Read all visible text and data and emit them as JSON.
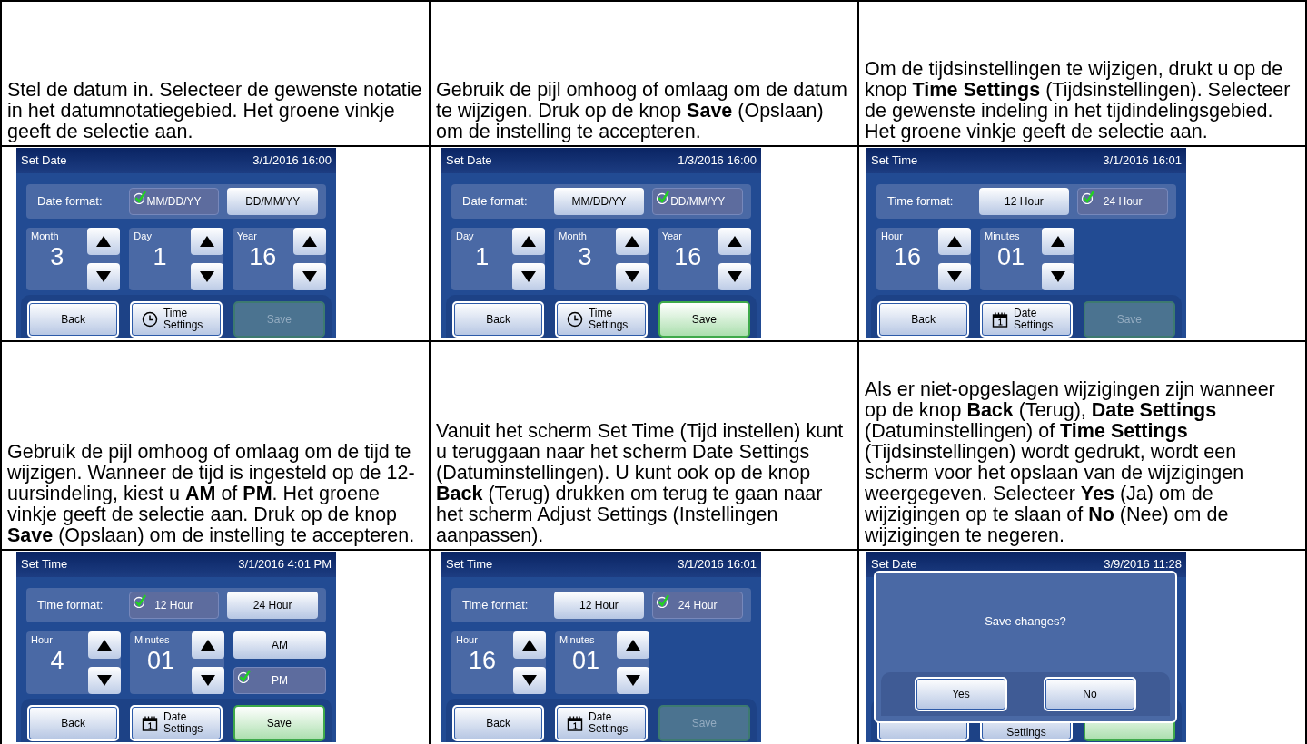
{
  "steps": [
    {
      "instruction": "Stel de datum in. Selecteer de gewenste notatie in het datumnotatiegebied. Het groene vinkje geeft de selectie aan.",
      "screen": {
        "kind": "settings",
        "title": "Set Date",
        "datetime": "3/1/2016 16:00",
        "format": {
          "label": "Date format:",
          "options": [
            {
              "label": "MM/DD/YY",
              "selected": true
            },
            {
              "label": "DD/MM/YY",
              "selected": false
            }
          ]
        },
        "spinners": [
          {
            "label": "Month",
            "value": "3"
          },
          {
            "label": "Day",
            "value": "1"
          },
          {
            "label": "Year",
            "value": "16"
          }
        ],
        "buttons": [
          {
            "kind": "plain",
            "label": "Back"
          },
          {
            "kind": "time",
            "label": "Time Settings"
          },
          {
            "kind": "save",
            "label": "Save",
            "disabled": true
          }
        ]
      }
    },
    {
      "instruction": "Gebruik de pijl omhoog of omlaag om de datum te wijzigen. Druk op de knop **Save** (Opslaan) om de instelling te accepteren.",
      "screen": {
        "kind": "settings",
        "title": "Set Date",
        "datetime": "1/3/2016 16:00",
        "format": {
          "label": "Date format:",
          "options": [
            {
              "label": "MM/DD/YY",
              "selected": false
            },
            {
              "label": "DD/MM/YY",
              "selected": true
            }
          ]
        },
        "spinners": [
          {
            "label": "Day",
            "value": "1"
          },
          {
            "label": "Month",
            "value": "3"
          },
          {
            "label": "Year",
            "value": "16"
          }
        ],
        "buttons": [
          {
            "kind": "plain",
            "label": "Back"
          },
          {
            "kind": "time",
            "label": "Time Settings"
          },
          {
            "kind": "save",
            "label": "Save",
            "disabled": false
          }
        ]
      }
    },
    {
      "instruction": "Om de tijdsinstellingen te wijzigen, drukt u op de knop **Time Settings** (Tijdsinstellingen). Selecteer de gewenste indeling in het tijdindelingsgebied. Het groene vinkje geeft de selectie aan.",
      "screen": {
        "kind": "settings",
        "title": "Set Time",
        "datetime": "3/1/2016 16:01",
        "format": {
          "label": "Time format:",
          "options": [
            {
              "label": "12 Hour",
              "selected": false
            },
            {
              "label": "24 Hour",
              "selected": true
            }
          ]
        },
        "spinners": [
          {
            "label": "Hour",
            "value": "16"
          },
          {
            "label": "Minutes",
            "value": "01"
          }
        ],
        "buttons": [
          {
            "kind": "plain",
            "label": "Back"
          },
          {
            "kind": "date",
            "label": "Date Settings"
          },
          {
            "kind": "save",
            "label": "Save",
            "disabled": true
          }
        ]
      }
    },
    {
      "instruction": "Gebruik de pijl omhoog of omlaag om de tijd te wijzigen. Wanneer de tijd is ingesteld op de 12-uursindeling, kiest u **AM** of **PM**. Het groene vinkje geeft de selectie aan. Druk op de knop **Save** (Opslaan) om de instelling te accepteren.",
      "screen": {
        "kind": "settings",
        "title": "Set Time",
        "datetime": "3/1/2016 4:01 PM",
        "format": {
          "label": "Time format:",
          "options": [
            {
              "label": "12 Hour",
              "selected": true
            },
            {
              "label": "24 Hour",
              "selected": false
            }
          ]
        },
        "spinners": [
          {
            "label": "Hour",
            "value": "4"
          },
          {
            "label": "Minutes",
            "value": "01"
          }
        ],
        "ampm": [
          {
            "label": "AM",
            "selected": false
          },
          {
            "label": "PM",
            "selected": true
          }
        ],
        "buttons": [
          {
            "kind": "plain",
            "label": "Back"
          },
          {
            "kind": "date",
            "label": "Date Settings"
          },
          {
            "kind": "save",
            "label": "Save",
            "disabled": false
          }
        ]
      }
    },
    {
      "instruction": "Vanuit het scherm Set Time (Tijd instellen) kunt u teruggaan naar het scherm Date Settings (Datuminstellingen). U kunt ook op de knop **Back** (Terug) drukken om terug te gaan naar het scherm Adjust Settings (Instellingen aanpassen).",
      "screen": {
        "kind": "settings",
        "title": "Set Time",
        "datetime": "3/1/2016 16:01",
        "format": {
          "label": "Time format:",
          "options": [
            {
              "label": "12 Hour",
              "selected": false
            },
            {
              "label": "24 Hour",
              "selected": true
            }
          ]
        },
        "spinners": [
          {
            "label": "Hour",
            "value": "16"
          },
          {
            "label": "Minutes",
            "value": "01"
          }
        ],
        "buttons": [
          {
            "kind": "plain",
            "label": "Back"
          },
          {
            "kind": "date",
            "label": "Date Settings"
          },
          {
            "kind": "save",
            "label": "Save",
            "disabled": true
          }
        ]
      }
    },
    {
      "instruction": "Als er niet-opgeslagen wijzigingen zijn wanneer op de knop **Back** (Terug), **Date Settings** (Datuminstellingen) of **Time Settings** (Tijdsinstellingen) wordt gedrukt, wordt een scherm voor het opslaan van de wijzigingen weergegeven. Selecteer **Yes** (Ja) om de wijzigingen op te slaan of **No** (Nee) om de wijzigingen te negeren.",
      "screen": {
        "kind": "dialog",
        "title": "Set Date",
        "datetime": "3/9/2016 11:28",
        "buttons": [
          {
            "kind": "plain"
          },
          {
            "kind": "plain",
            "label": "Settings"
          },
          {
            "kind": "save",
            "disabled": false
          }
        ],
        "dialog": {
          "message": "Save changes?",
          "buttons": [
            "Yes",
            "No"
          ]
        }
      }
    }
  ]
}
